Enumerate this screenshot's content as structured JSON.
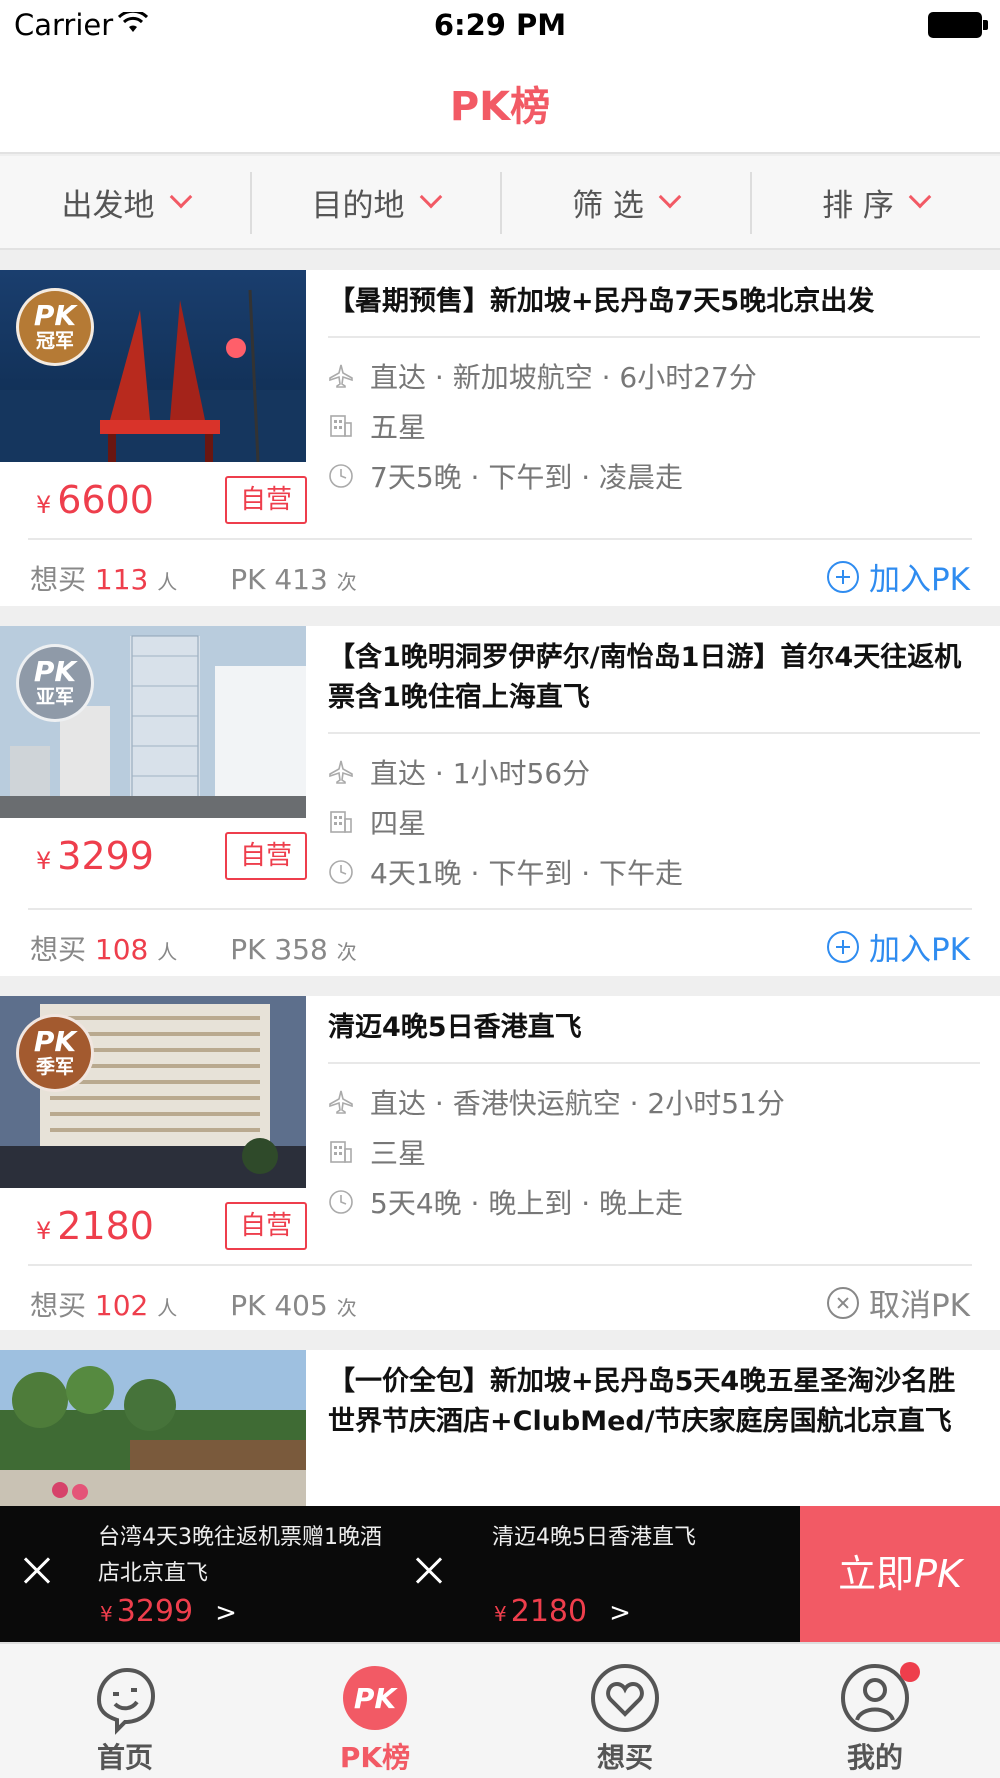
{
  "status": {
    "carrier": "Carrier",
    "time": "6:29 PM"
  },
  "nav": {
    "title": "PK榜"
  },
  "filters": [
    {
      "label": "出发地"
    },
    {
      "label": "目的地"
    },
    {
      "label": "筛 选"
    },
    {
      "label": "排 序"
    }
  ],
  "cards": [
    {
      "badge_top": "PK",
      "badge_bottom": "冠军",
      "price_currency": "¥",
      "price": "6600",
      "tag": "自营",
      "title": "【暑期预售】新加坡+民丹岛7天5晚北京出发",
      "flight": "直达 · 新加坡航空 · 6小时27分",
      "hotel": "五星",
      "schedule": "7天5晚 · 下午到 · 凌晨走",
      "want_label": "想买",
      "want_count": "113",
      "want_unit": "人",
      "pk_label": "PK",
      "pk_count": "413",
      "pk_unit": "次",
      "action": "加入PK"
    },
    {
      "badge_top": "PK",
      "badge_bottom": "亚军",
      "price_currency": "¥",
      "price": "3299",
      "tag": "自营",
      "title": "【含1晚明洞罗伊萨尔/南怡岛1日游】首尔4天往返机票含1晚住宿上海直飞",
      "flight": "直达 · 1小时56分",
      "hotel": "四星",
      "schedule": "4天1晚 · 下午到 · 下午走",
      "want_label": "想买",
      "want_count": "108",
      "want_unit": "人",
      "pk_label": "PK",
      "pk_count": "358",
      "pk_unit": "次",
      "action": "加入PK"
    },
    {
      "badge_top": "PK",
      "badge_bottom": "季军",
      "price_currency": "¥",
      "price": "2180",
      "tag": "自营",
      "title": "清迈4晚5日香港直飞",
      "flight": "直达 · 香港快运航空 · 2小时51分",
      "hotel": "三星",
      "schedule": "5天4晚 · 晚上到 · 晚上走",
      "want_label": "想买",
      "want_count": "102",
      "want_unit": "人",
      "pk_label": "PK",
      "pk_count": "405",
      "pk_unit": "次",
      "action": "取消PK"
    },
    {
      "title": "【一价全包】新加坡+民丹岛5天4晚五星圣淘沙名胜世界节庆酒店+ClubMed/节庆家庭房国航北京直飞"
    }
  ],
  "pk_bar": {
    "items": [
      {
        "name": "台湾4天3晚往返机票赠1晚酒店北京直飞",
        "currency": "¥",
        "price": "3299",
        "arrow": ">"
      },
      {
        "name": "清迈4晚5日香港直飞",
        "currency": "¥",
        "price": "2180",
        "arrow": ">"
      }
    ],
    "cta_prefix": "立即",
    "cta_suffix": "PK"
  },
  "tabs": [
    {
      "label": "首页",
      "icon": "home-face-icon"
    },
    {
      "label": "PK榜",
      "icon": "pk-icon"
    },
    {
      "label": "想买",
      "icon": "heart-icon"
    },
    {
      "label": "我的",
      "icon": "user-icon"
    }
  ],
  "colors": {
    "accent": "#f25a65",
    "price": "#ee3e4c",
    "link": "#2f8cf0"
  }
}
